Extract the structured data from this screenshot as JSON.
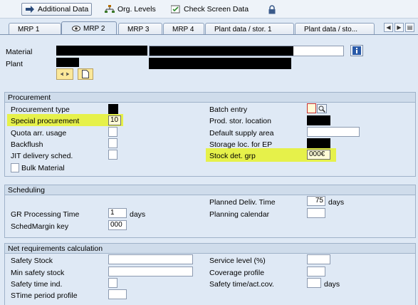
{
  "toolbar": {
    "additional_data": "Additional Data",
    "org_levels": "Org. Levels",
    "check_screen_data": "Check Screen Data"
  },
  "tabs": [
    "MRP 1",
    "MRP 2",
    "MRP 3",
    "MRP 4",
    "Plant data / stor. 1",
    "Plant data / sto..."
  ],
  "active_tab": "MRP 2",
  "header": {
    "material_label": "Material",
    "plant_label": "Plant"
  },
  "procurement": {
    "title": "Procurement",
    "procurement_type_label": "Procurement type",
    "special_procurement_label": "Special procurement",
    "special_procurement_value": "10",
    "quota_arr_usage_label": "Quota arr. usage",
    "backflush_label": "Backflush",
    "jit_delivery_label": "JIT delivery sched.",
    "bulk_material_label": "Bulk Material",
    "batch_entry_label": "Batch entry",
    "prod_stor_location_label": "Prod. stor. location",
    "default_supply_area_label": "Default supply area",
    "storage_loc_ep_label": "Storage loc. for EP",
    "stock_det_grp_label": "Stock det. grp",
    "stock_det_grp_value": "000€"
  },
  "scheduling": {
    "title": "Scheduling",
    "planned_deliv_time_label": "Planned Deliv. Time",
    "planned_deliv_time_value": "75",
    "planned_deliv_time_unit": "days",
    "gr_processing_time_label": "GR Processing Time",
    "gr_processing_time_value": "1",
    "gr_processing_time_unit": "days",
    "planning_calendar_label": "Planning calendar",
    "sched_margin_key_label": "SchedMargin key",
    "sched_margin_key_value": "000"
  },
  "net_requirements": {
    "title": "Net requirements calculation",
    "safety_stock_label": "Safety Stock",
    "min_safety_stock_label": "Min safety stock",
    "safety_time_ind_label": "Safety time ind.",
    "stime_period_profile_label": "STime period profile",
    "service_level_label": "Service level (%)",
    "coverage_profile_label": "Coverage profile",
    "safety_time_act_cov_label": "Safety time/act.cov.",
    "safety_time_act_cov_unit": "days"
  },
  "colors": {
    "background": "#dfe9f5",
    "highlight": "#e6f14a",
    "field_border": "#8c9ab0"
  }
}
